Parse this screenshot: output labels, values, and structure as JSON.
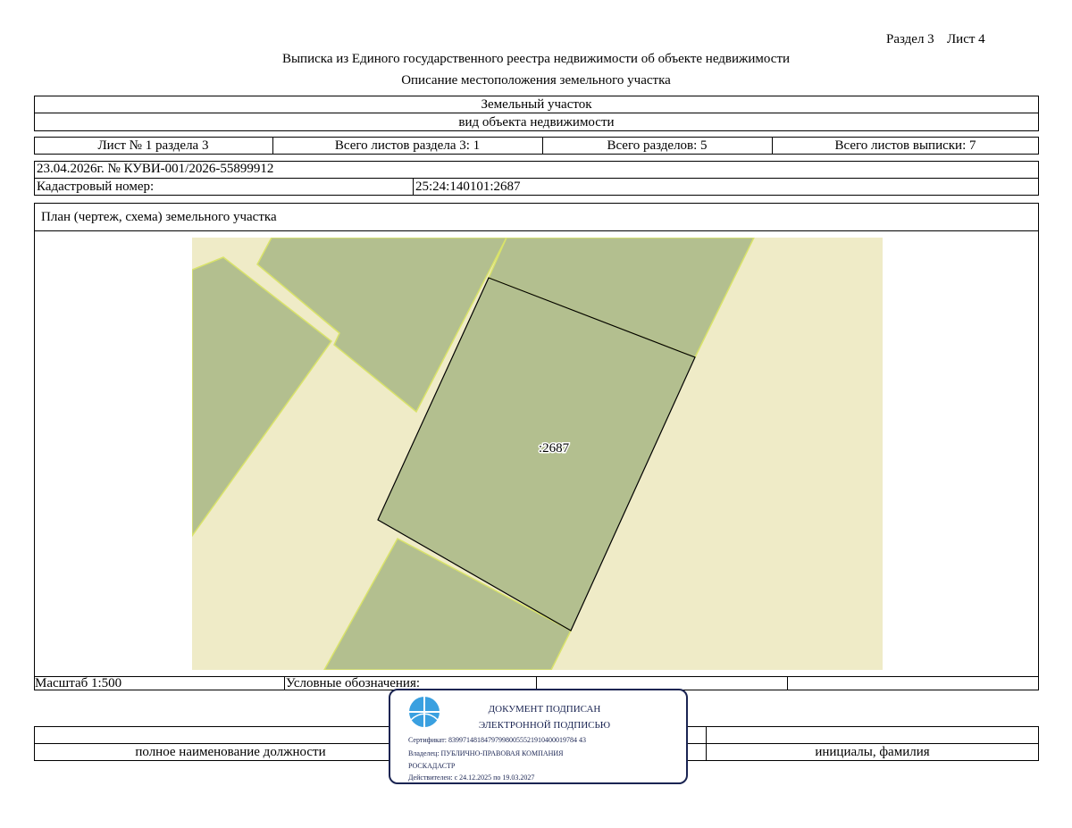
{
  "header": {
    "section": "Раздел 3",
    "sheet": "Лист 4",
    "title": "Выписка из Единого государственного реестра недвижимости об объекте недвижимости",
    "subtitle": "Описание местоположения земельного участка"
  },
  "object": {
    "type": "Земельный участок",
    "type_caption": "вид объекта недвижимости"
  },
  "sheets_row": {
    "sheet_no": "Лист № 1 раздела 3",
    "total_sheets_section": "Всего листов раздела 3: 1",
    "total_sections": "Всего разделов: 5",
    "total_sheets_extract": "Всего листов выписки: 7"
  },
  "document": {
    "date_number": "23.04.2026г. № КУВИ-001/2026-55899912",
    "cadastral_label": "Кадастровый номер:",
    "cadastral_number": "25:24:140101:2687"
  },
  "plan": {
    "title": "План (чертеж, схема) земельного участка",
    "parcel_label": ":2687",
    "colors": {
      "background": "#efebc7",
      "parcel": "#b3bf8f",
      "border": "#000000",
      "neighbor_edge": "#d9e36a"
    }
  },
  "legend_row": {
    "scale": "Масштаб 1:500",
    "legend": "Условные обозначения:"
  },
  "signature_row": {
    "position_caption": "полное наименование должности",
    "name_caption": "инициалы, фамилия"
  },
  "stamp": {
    "line1": "ДОКУМЕНТ ПОДПИСАН",
    "line2": "ЭЛЕКТРОННОЙ ПОДПИСЬЮ",
    "certificate": "Сертификат: 839971481847979980055521910400019784 43",
    "owner_line1": "Владелец: ПУБЛИЧНО-ПРАВОВАЯ КОМПАНИЯ",
    "owner_line2": "РОСКАДАСТР",
    "valid": "Действителен: с 24.12.2025 по 19.03.2027",
    "icon": "globe-icon"
  }
}
